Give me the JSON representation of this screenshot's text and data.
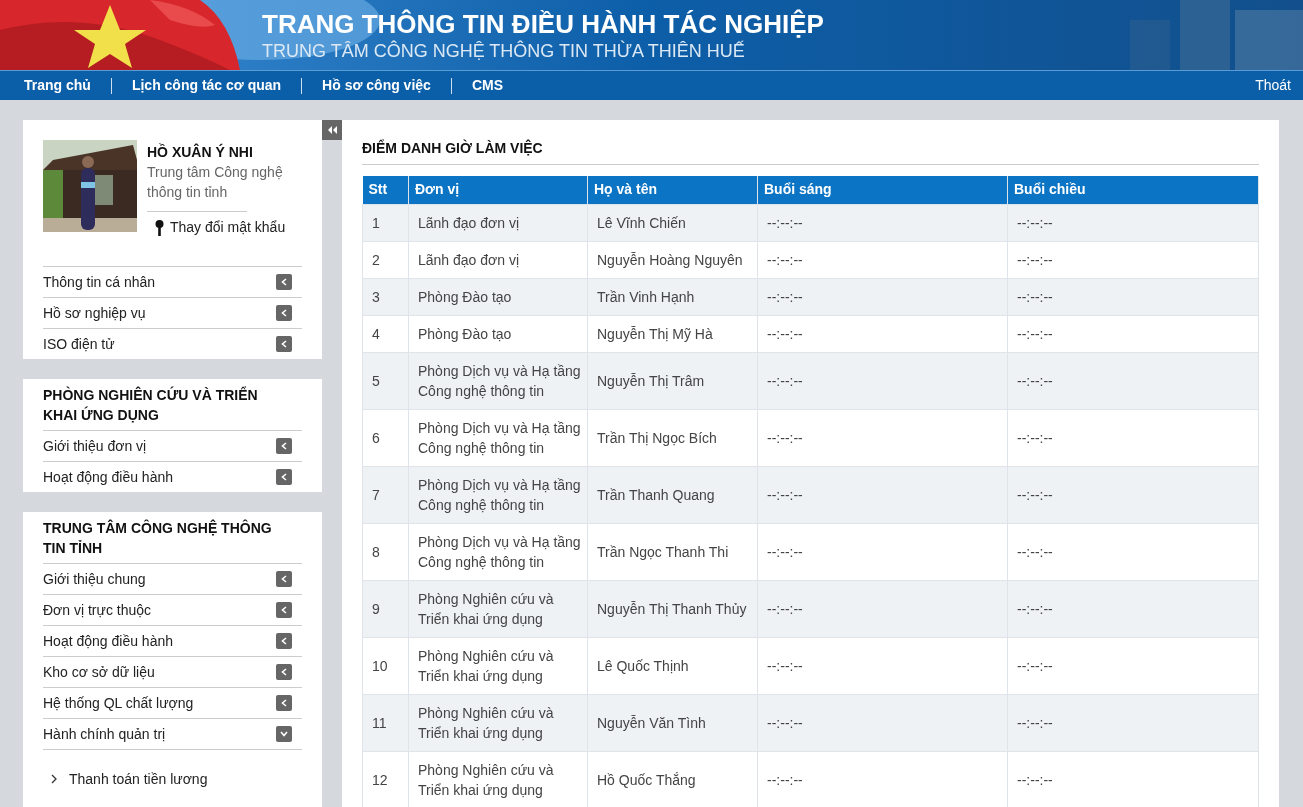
{
  "header": {
    "title": "TRANG THÔNG TIN ĐIỀU HÀNH TÁC NGHIỆP",
    "subtitle": "TRUNG TÂM CÔNG NGHỆ THÔNG TIN THỪA THIÊN HUẾ"
  },
  "nav": {
    "items": [
      "Trang chủ",
      "Lịch công tác cơ quan",
      "Hồ sơ công việc",
      "CMS"
    ],
    "logout": "Thoát"
  },
  "sidebar": {
    "profile": {
      "name": "HỒ XUÂN Ý NHI",
      "unit": "Trung tâm Công nghệ thông tin tỉnh",
      "change_password": "Thay đổi mật khẩu",
      "items": [
        {
          "label": "Thông tin cá nhân",
          "expanded": false
        },
        {
          "label": "Hồ sơ nghiệp vụ",
          "expanded": false
        },
        {
          "label": "ISO điện tử",
          "expanded": false
        }
      ]
    },
    "sections": [
      {
        "title": "PHÒNG NGHIÊN CỨU VÀ TRIỂN KHAI ỨNG DỤNG",
        "items": [
          {
            "label": "Giới thiệu đơn vị",
            "expanded": false
          },
          {
            "label": "Hoạt động điều hành",
            "expanded": false
          }
        ]
      },
      {
        "title": "TRUNG TÂM CÔNG NGHỆ THÔNG TIN TỈNH",
        "items": [
          {
            "label": "Giới thiệu chung",
            "expanded": false
          },
          {
            "label": "Đơn vị trực thuộc",
            "expanded": false
          },
          {
            "label": "Hoạt động điều hành",
            "expanded": false
          },
          {
            "label": "Kho cơ sở dữ liệu",
            "expanded": false
          },
          {
            "label": "Hệ thống QL chất lượng",
            "expanded": false
          },
          {
            "label": "Hành chính quản trị",
            "expanded": true,
            "children": [
              "Thanh toán tiền lương"
            ]
          }
        ]
      }
    ]
  },
  "main": {
    "title": "ĐIỂM DANH GIỜ LÀM VIỆC",
    "table": {
      "columns": [
        "Stt",
        "Đơn vị",
        "Họ và tên",
        "Buổi sáng",
        "Buổi chiều"
      ],
      "rows": [
        [
          "1",
          "Lãnh đạo đơn vị",
          "Lê Vĩnh Chiến",
          "--:--:--",
          "--:--:--"
        ],
        [
          "2",
          "Lãnh đạo đơn vị",
          "Nguyễn Hoàng Nguyên",
          "--:--:--",
          "--:--:--"
        ],
        [
          "3",
          "Phòng Đào tạo",
          "Trần Vinh Hạnh",
          "--:--:--",
          "--:--:--"
        ],
        [
          "4",
          "Phòng Đào tạo",
          "Nguyễn Thị Mỹ Hà",
          "--:--:--",
          "--:--:--"
        ],
        [
          "5",
          "Phòng Dịch vụ và Hạ tầng Công nghệ thông tin",
          "Nguyễn Thị Trâm",
          "--:--:--",
          "--:--:--"
        ],
        [
          "6",
          "Phòng Dịch vụ và Hạ tầng Công nghệ thông tin",
          "Trần Thị Ngọc Bích",
          "--:--:--",
          "--:--:--"
        ],
        [
          "7",
          "Phòng Dịch vụ và Hạ tầng Công nghệ thông tin",
          "Trần Thanh Quang",
          "--:--:--",
          "--:--:--"
        ],
        [
          "8",
          "Phòng Dịch vụ và Hạ tầng Công nghệ thông tin",
          "Trần Ngọc Thanh Thi",
          "--:--:--",
          "--:--:--"
        ],
        [
          "9",
          "Phòng Nghiên cứu và Triển khai ứng dụng",
          "Nguyễn Thị Thanh Thủy",
          "--:--:--",
          "--:--:--"
        ],
        [
          "10",
          "Phòng Nghiên cứu và Triển khai ứng dụng",
          "Lê Quốc Thịnh",
          "--:--:--",
          "--:--:--"
        ],
        [
          "11",
          "Phòng Nghiên cứu và Triển khai ứng dụng",
          "Nguyễn Văn Tình",
          "--:--:--",
          "--:--:--"
        ],
        [
          "12",
          "Phòng Nghiên cứu và Triển khai ứng dụng",
          "Hồ Quốc Thắng",
          "--:--:--",
          "--:--:--"
        ]
      ]
    }
  }
}
